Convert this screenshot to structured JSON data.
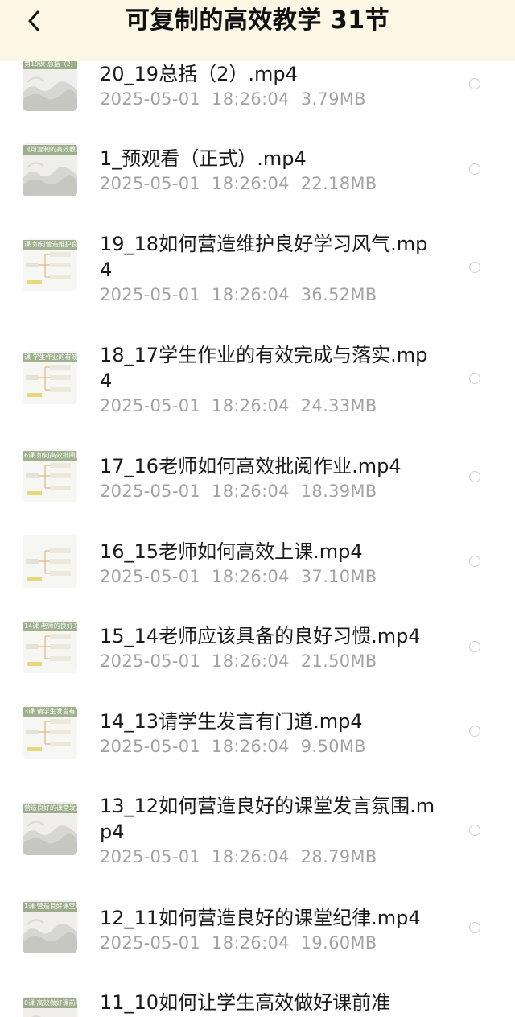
{
  "header": {
    "title": "可复制的高效教学 31节",
    "back_icon": "chevron-left-icon"
  },
  "colors": {
    "header_bg": "#fcf6e4",
    "name_text": "#1a1a1a",
    "meta_text": "#a3a3a3",
    "radio_border": "#cfcfcf"
  },
  "files": [
    {
      "name": "20_19总括（2）.mp4",
      "date": "2025-05-01",
      "time": "18:26:04",
      "size": "3.79MB",
      "thumb_caption": "第19课 总括（2）",
      "thumb_style": "landscape"
    },
    {
      "name": "1_预观看（正式）.mp4",
      "date": "2025-05-01",
      "time": "18:26:04",
      "size": "22.18MB",
      "thumb_caption": "《可复制的高效教学》前言",
      "thumb_style": "landscape"
    },
    {
      "name": "19_18如何营造维护良好学习风气.mp4",
      "date": "2025-05-01",
      "time": "18:26:04",
      "size": "36.52MB",
      "thumb_caption": "课 如何营造维护良好学习",
      "thumb_style": "mindmap"
    },
    {
      "name": "18_17学生作业的有效完成与落实.mp4",
      "date": "2025-05-01",
      "time": "18:26:04",
      "size": "24.33MB",
      "thumb_caption": "课 学生作业的有效完成",
      "thumb_style": "mindmap"
    },
    {
      "name": "17_16老师如何高效批阅作业.mp4",
      "date": "2025-05-01",
      "time": "18:26:04",
      "size": "18.39MB",
      "thumb_caption": "6课 如何高效批阅作业",
      "thumb_style": "mindmap"
    },
    {
      "name": "16_15老师如何高效上课.mp4",
      "date": "2025-05-01",
      "time": "18:26:04",
      "size": "37.10MB",
      "thumb_caption": "",
      "thumb_style": "mindmap"
    },
    {
      "name": "15_14老师应该具备的良好习惯.mp4",
      "date": "2025-05-01",
      "time": "18:26:04",
      "size": "21.50MB",
      "thumb_caption": "14课 老师的良好习惯",
      "thumb_style": "mindmap"
    },
    {
      "name": "14_13请学生发言有门道.mp4",
      "date": "2025-05-01",
      "time": "18:26:04",
      "size": "9.50MB",
      "thumb_caption": "3课 请学生发言有门道",
      "thumb_style": "mindmap"
    },
    {
      "name": "13_12如何营造良好的课堂发言氛围.mp4",
      "date": "2025-05-01",
      "time": "18:26:04",
      "size": "28.79MB",
      "thumb_caption": "营造良好的课堂发言",
      "thumb_style": "landscape"
    },
    {
      "name": "12_11如何营造良好的课堂纪律.mp4",
      "date": "2025-05-01",
      "time": "18:26:04",
      "size": "19.60MB",
      "thumb_caption": "1课 营造良好课堂纪律",
      "thumb_style": "landscape"
    },
    {
      "name": "11_10如何让学生高效做好课前准",
      "date": "",
      "time": "",
      "size": "",
      "thumb_caption": "0课 高效做好课前准",
      "thumb_style": "landscape"
    }
  ]
}
